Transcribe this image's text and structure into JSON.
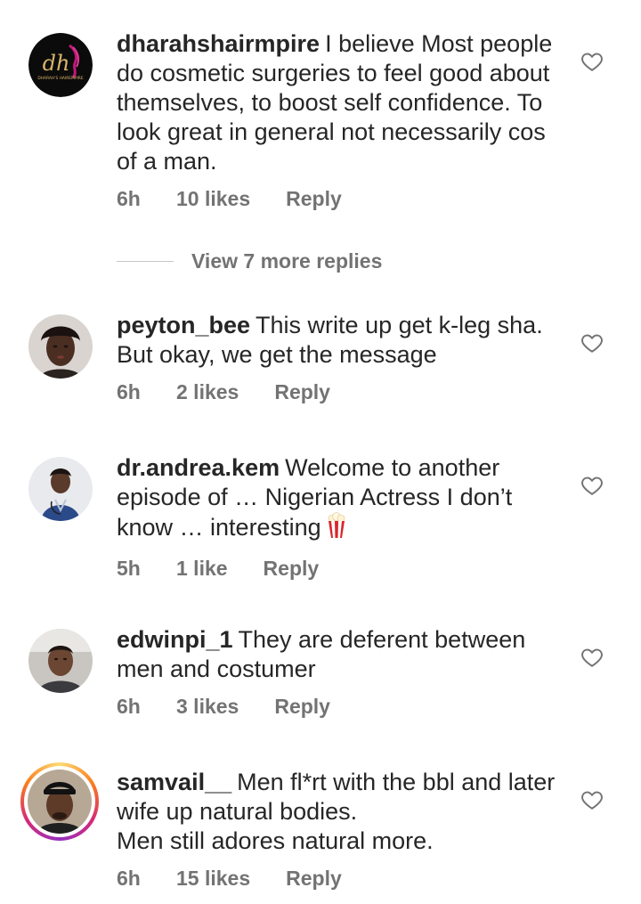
{
  "comments": [
    {
      "username": "dharahshairmpire",
      "text": "I believe Most people do cosmetic surgeries to feel good about themselves, to boost self confidence. To look great in general not necessarily cos of a man.",
      "time": "6h",
      "likes": "10 likes",
      "reply": "Reply",
      "avatar_initials": "dh",
      "avatar_caption": "DHARAH'S HAIREMPIRE"
    },
    {
      "username": "peyton_bee",
      "text": "This write up get k-leg sha. But okay, we get the message",
      "time": "6h",
      "likes": "2 likes",
      "reply": "Reply"
    },
    {
      "username": "dr.andrea.kem",
      "text": "Welcome to another episode of … Nigerian Actress I don’t know … interesting",
      "time": "5h",
      "likes": "1 like",
      "reply": "Reply",
      "emoji": "popcorn-icon"
    },
    {
      "username": "edwinpi_1",
      "text": "They are deferent between men and costumer",
      "time": "6h",
      "likes": "3 likes",
      "reply": "Reply"
    },
    {
      "username": "samvail__",
      "text": "Men fl*rt with the bbl and later wife up natural bodies.\nMen still adores natural more.",
      "time": "6h",
      "likes": "15 likes",
      "reply": "Reply"
    }
  ],
  "view_replies": "View 7 more replies",
  "colors": {
    "text": "#262626",
    "meta": "#737373",
    "divider": "#c7c7c7"
  }
}
